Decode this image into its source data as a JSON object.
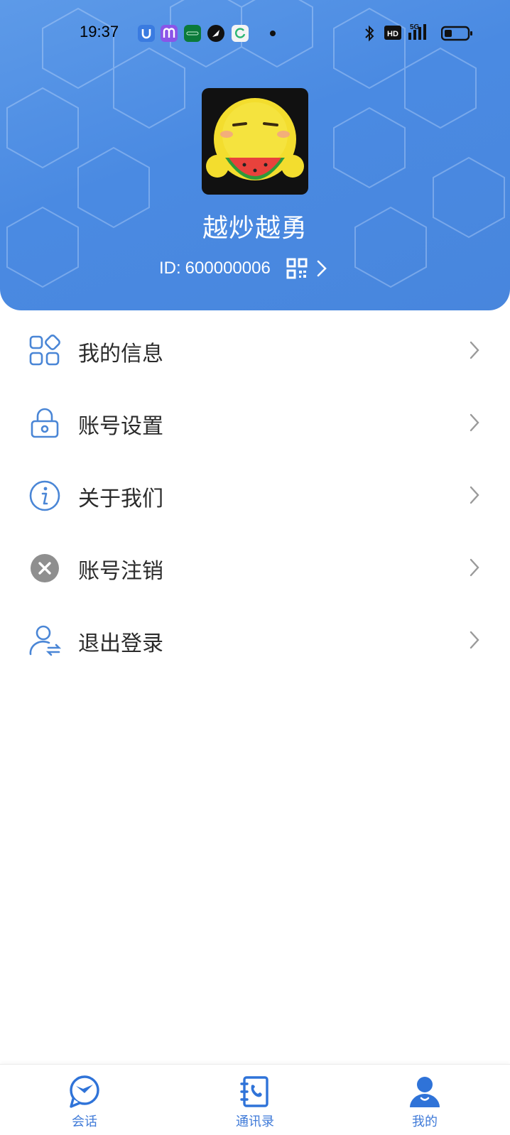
{
  "status_bar": {
    "time": "19:37",
    "notification_icons": [
      "u-app-icon",
      "m-app-icon",
      "oppo-app-icon",
      "feather-app-icon",
      "refresh-app-icon"
    ],
    "system_icons": [
      "bluetooth-icon",
      "hd-icon",
      "5g-signal-icon",
      "battery-icon"
    ],
    "network": "5G",
    "hd": "HD"
  },
  "profile": {
    "nickname": "越炒越勇",
    "id_label": "ID:",
    "id_value": "600000006",
    "qr_icon": "qr-code-icon",
    "chevron_icon": "chevron-right-icon"
  },
  "menu": {
    "items": [
      {
        "label": "我的信息",
        "icon": "grid-icon"
      },
      {
        "label": "账号设置",
        "icon": "lock-icon"
      },
      {
        "label": "关于我们",
        "icon": "info-icon"
      },
      {
        "label": "账号注销",
        "icon": "close-circle-icon"
      },
      {
        "label": "退出登录",
        "icon": "user-switch-icon"
      }
    ]
  },
  "tabbar": {
    "tabs": [
      {
        "label": "会话",
        "icon": "chat-icon"
      },
      {
        "label": "通讯录",
        "icon": "contacts-icon"
      },
      {
        "label": "我的",
        "icon": "person-icon",
        "active": true
      }
    ]
  },
  "colors": {
    "accent": "#4a8ae2",
    "icon_blue": "#4a86d6",
    "tab_blue": "#2f73d8",
    "chevron": "#9a9a9a",
    "grey_icon": "#8f8f8f"
  }
}
